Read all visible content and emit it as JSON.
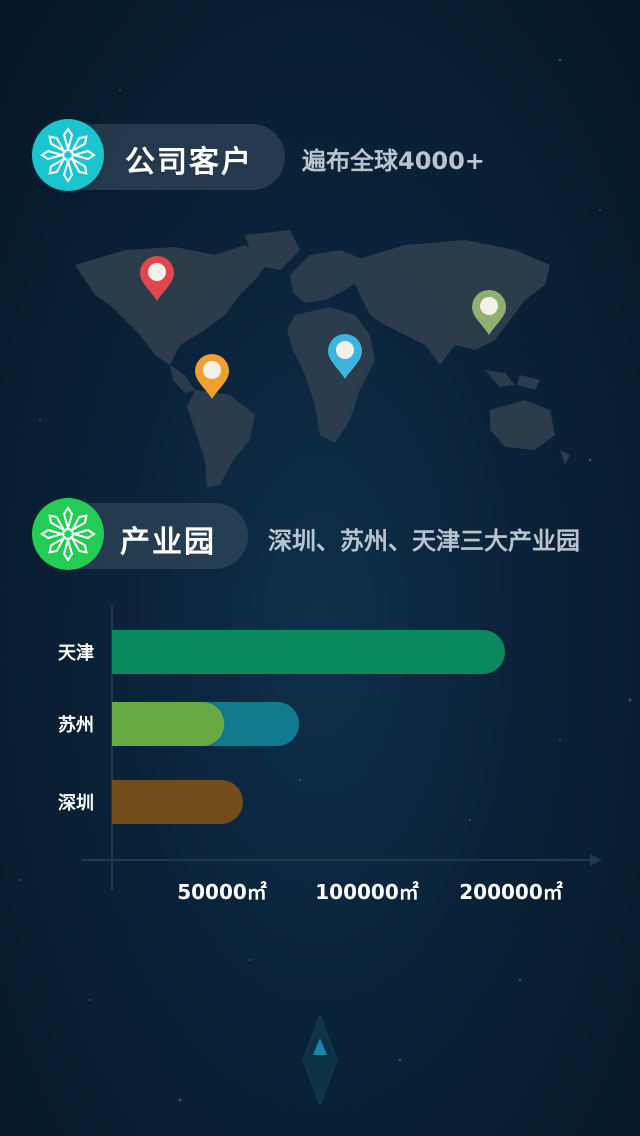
{
  "section_customers": {
    "title": "公司客户",
    "subtitle": "遍布全球4000+",
    "badge_color": "#1bc5cf"
  },
  "section_parks": {
    "title": "产业园",
    "subtitle": "深圳、苏州、天津三大产业园",
    "badge_color": "#22cc55"
  },
  "map_pins": [
    {
      "name": "north-america",
      "color": "#e0474c"
    },
    {
      "name": "south-america",
      "color": "#f0a030"
    },
    {
      "name": "africa",
      "color": "#3db3e0"
    },
    {
      "name": "east-asia",
      "color": "#8fb070"
    }
  ],
  "chart_data": {
    "type": "bar",
    "orientation": "horizontal",
    "categories": [
      "天津",
      "苏州",
      "深圳"
    ],
    "series": [
      {
        "values": [
          210000,
          100000,
          70000
        ],
        "colors": [
          "#0b8a5e",
          "#0f7b8c",
          "#734c1c"
        ]
      },
      {
        "values": [
          null,
          60000,
          null
        ],
        "colors": [
          "#0b8a5e",
          "#6aaa45",
          "#734c1c"
        ]
      }
    ],
    "x_ticks": [
      "50000㎡",
      "100000㎡",
      "200000㎡"
    ]
  }
}
